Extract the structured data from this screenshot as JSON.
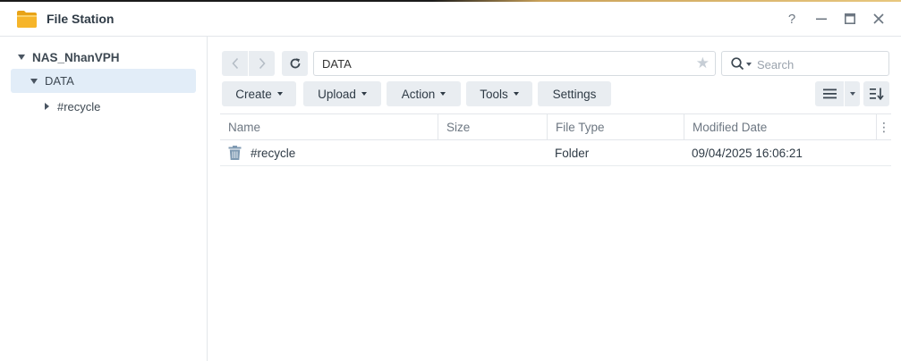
{
  "window": {
    "title": "File Station"
  },
  "titlebar": {
    "help": "?",
    "minimize": "—",
    "maximize": "▣",
    "close": "✕"
  },
  "sidebar": {
    "root": "NAS_NhanVPH",
    "items": [
      {
        "label": "DATA",
        "selected": true,
        "expanded": true
      },
      {
        "label": "#recycle",
        "selected": false,
        "expanded": false
      }
    ]
  },
  "toolbar": {
    "path": "DATA",
    "search_placeholder": "Search",
    "buttons": {
      "create": "Create",
      "upload": "Upload",
      "action": "Action",
      "tools": "Tools",
      "settings": "Settings"
    }
  },
  "table": {
    "columns": [
      "Name",
      "Size",
      "File Type",
      "Modified Date"
    ],
    "rows": [
      {
        "name": "#recycle",
        "size": "",
        "type": "Folder",
        "modified": "09/04/2025 16:06:21",
        "icon": "trash-icon"
      }
    ]
  },
  "colors": {
    "accent": "#e2edf8",
    "button_bg": "#e9edf1",
    "text": "#2f3b46",
    "muted": "#6d7782",
    "folder": "#f5b324"
  }
}
